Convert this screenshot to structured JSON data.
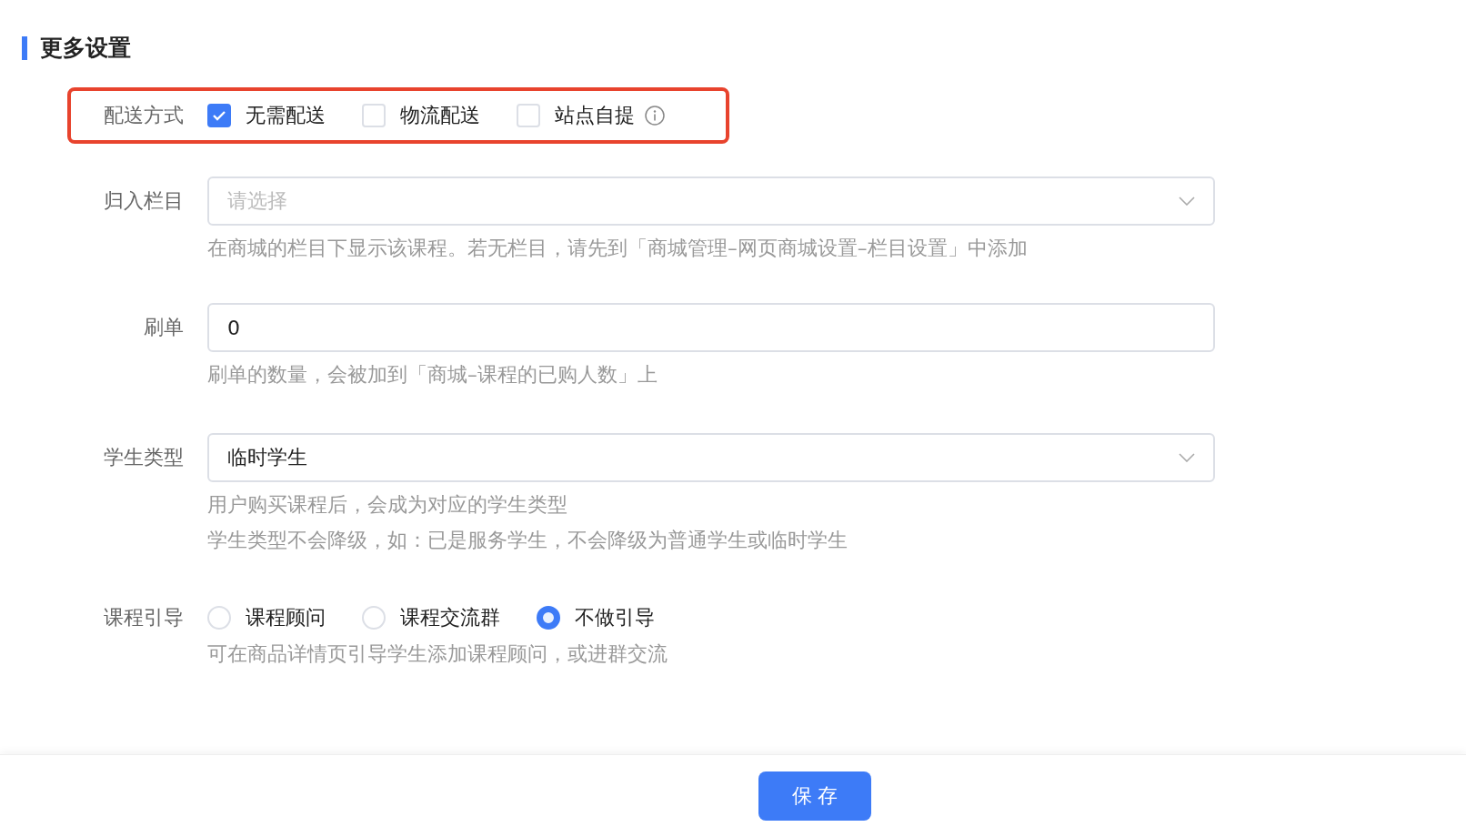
{
  "section_title": "更多设置",
  "delivery": {
    "label": "配送方式",
    "highlighted": true,
    "options": [
      {
        "label": "无需配送",
        "checked": true,
        "info": false
      },
      {
        "label": "物流配送",
        "checked": false,
        "info": false
      },
      {
        "label": "站点自提",
        "checked": false,
        "info": true
      }
    ]
  },
  "category": {
    "label": "归入栏目",
    "placeholder": "请选择",
    "help": [
      "在商城的栏目下显示该课程。若无栏目，请先到「商城管理–网页商城设置–栏目设置」中添加"
    ]
  },
  "fake_orders": {
    "label": "刷单",
    "value": "0",
    "help": [
      "刷单的数量，会被加到「商城–课程的已购人数」上"
    ]
  },
  "student_type": {
    "label": "学生类型",
    "value": "临时学生",
    "help": [
      "用户购买课程后，会成为对应的学生类型",
      "学生类型不会降级，如：已是服务学生，不会降级为普通学生或临时学生"
    ]
  },
  "guide": {
    "label": "课程引导",
    "options": [
      {
        "label": "课程顾问",
        "selected": false
      },
      {
        "label": "课程交流群",
        "selected": false
      },
      {
        "label": "不做引导",
        "selected": true
      }
    ],
    "help": [
      "可在商品详情页引导学生添加课程顾问，或进群交流"
    ]
  },
  "save_button": "保 存"
}
